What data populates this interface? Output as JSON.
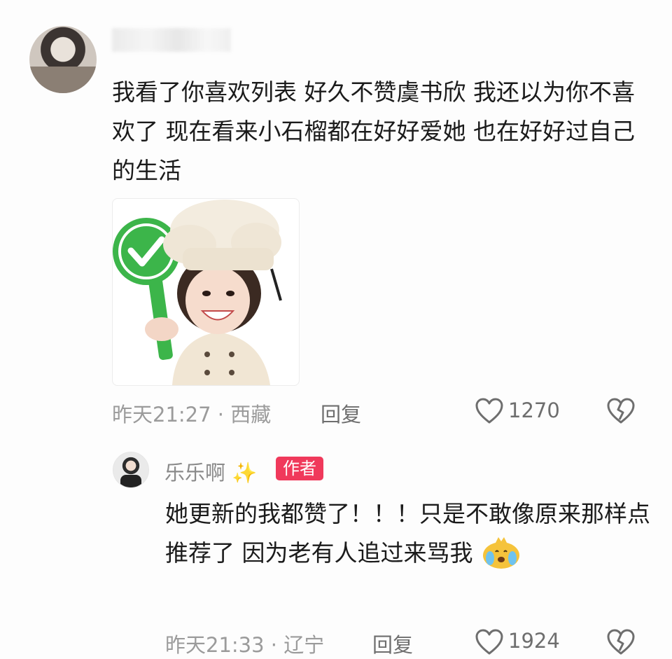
{
  "comment": {
    "text": "我看了你喜欢列表 好久不赞虞书欣 我还以为你不喜欢了 现在看来小石榴都在好好爱她 也在好好过自己的生活",
    "time": "昨天21:27",
    "separator": "·",
    "location": "西藏",
    "reply_label": "回复",
    "like_count": "1270"
  },
  "reply": {
    "username": "乐乐啊",
    "badge": "作者",
    "text": "她更新的我都赞了！！！只是不敢像原来那样点推荐了 因为老有人追过来骂我",
    "time": "昨天21:33",
    "separator": "·",
    "location": "辽宁",
    "reply_label": "回复",
    "like_count": "1924"
  },
  "icons": {
    "like": "heart-outline-icon",
    "dislike": "broken-heart-icon",
    "sparkle": "sparkles-icon",
    "crying": "crying-face-emoji",
    "check": "checkmark-sign-icon"
  },
  "colors": {
    "author_badge": "#f0395b",
    "check_sign": "#3cb54a"
  }
}
